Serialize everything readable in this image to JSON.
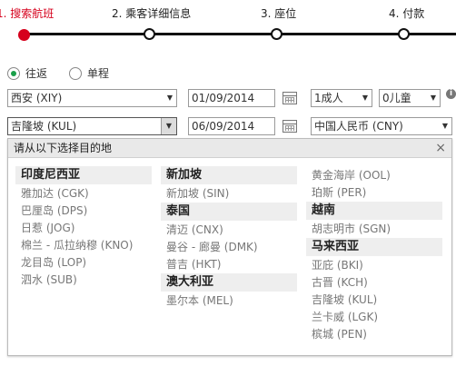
{
  "steps": [
    {
      "label": "1. 搜索航班",
      "active": true
    },
    {
      "label": "2. 乘客详细信息"
    },
    {
      "label": "3. 座位"
    },
    {
      "label": "4. 付款"
    }
  ],
  "trip": {
    "roundtrip": "往返",
    "oneway": "单程",
    "selected": "roundtrip"
  },
  "search": {
    "origin": "西安 (XIY)",
    "destination": "吉隆坡 (KUL)",
    "depart_date": "01/09/2014",
    "return_date": "06/09/2014",
    "adults": "1成人",
    "children": "0儿童",
    "currency": "中国人民币 (CNY)",
    "info": "i"
  },
  "panel": {
    "title": "请从以下选择目的地",
    "close": "×",
    "columns": [
      [
        {
          "group": "印度尼西亚",
          "cities": [
            "雅加达 (CGK)",
            "巴厘岛 (DPS)",
            "日惹 (JOG)",
            "棉兰 - 瓜拉纳穆 (KNO)",
            "龙目岛 (LOP)",
            "泗水 (SUB)"
          ]
        }
      ],
      [
        {
          "group": "新加坡",
          "cities": [
            "新加坡 (SIN)"
          ]
        },
        {
          "group": "泰国",
          "cities": [
            "清迈 (CNX)",
            "曼谷 - 廊曼 (DMK)",
            "普吉 (HKT)"
          ]
        },
        {
          "group": "澳大利亚",
          "cities": [
            "墨尔本 (MEL)"
          ]
        }
      ],
      [
        {
          "group": "",
          "cities": [
            "黄金海岸 (OOL)",
            "珀斯 (PER)"
          ]
        },
        {
          "group": "越南",
          "cities": [
            "胡志明市 (SGN)"
          ]
        },
        {
          "group": "马来西亚",
          "cities": [
            "亚庇 (BKI)",
            "古晋 (KCH)",
            "吉隆坡 (KUL)",
            "兰卡威 (LGK)",
            "槟城 (PEN)"
          ]
        }
      ]
    ]
  }
}
